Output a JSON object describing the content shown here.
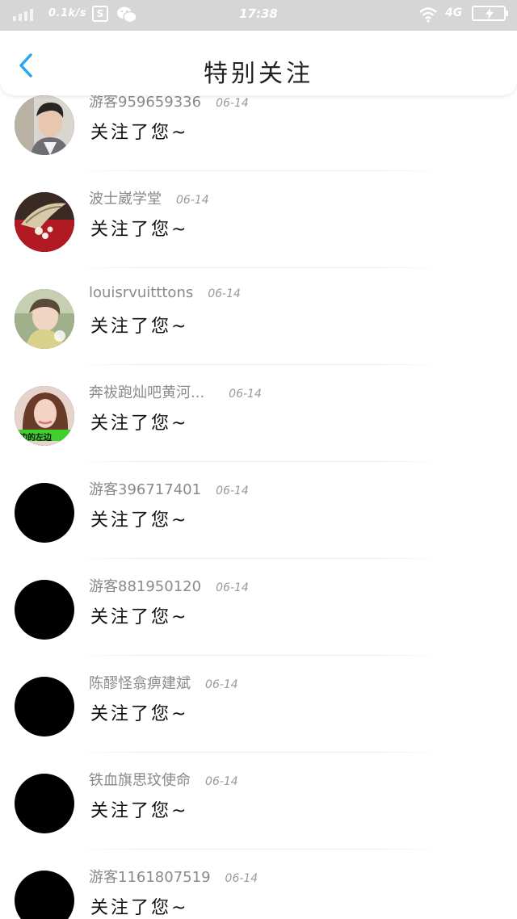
{
  "status_bar": {
    "speed": "0.1k/s",
    "s_icon": "S",
    "time": "17:38",
    "network": "4G",
    "icons": [
      "signal-icon",
      "s-app-icon",
      "wechat-icon",
      "wifi-icon",
      "battery-icon"
    ]
  },
  "header": {
    "title": "特别关注",
    "back_icon": "chevron-left-icon",
    "accent_color": "#2aa4f4"
  },
  "notifications": [
    {
      "name": "游客959659336",
      "date": "06-14",
      "message": "关注了您~",
      "avatar": "photo-young-man"
    },
    {
      "name": "波士崴学堂",
      "date": "06-14",
      "message": "关注了您~",
      "avatar": "photo-brooch"
    },
    {
      "name": "louisrvuitttons",
      "date": "06-14",
      "message": "关注了您~",
      "avatar": "photo-girl-scarf"
    },
    {
      "name": "奔祓跑灿吧黄河...",
      "date": "06-14",
      "message": "关注了您~",
      "avatar": "photo-woman",
      "avatar_caption": "边的左边"
    },
    {
      "name": "游客396717401",
      "date": "06-14",
      "message": "关注了您~",
      "avatar": "black"
    },
    {
      "name": "游客881950120",
      "date": "06-14",
      "message": "关注了您~",
      "avatar": "black"
    },
    {
      "name": "陈醪怪翕痹建斌",
      "date": "06-14",
      "message": "关注了您~",
      "avatar": "black"
    },
    {
      "name": "铁血旗思玟使命",
      "date": "06-14",
      "message": "关注了您~",
      "avatar": "black"
    },
    {
      "name": "游客1161807519",
      "date": "06-14",
      "message": "关注了您~",
      "avatar": "black"
    }
  ]
}
